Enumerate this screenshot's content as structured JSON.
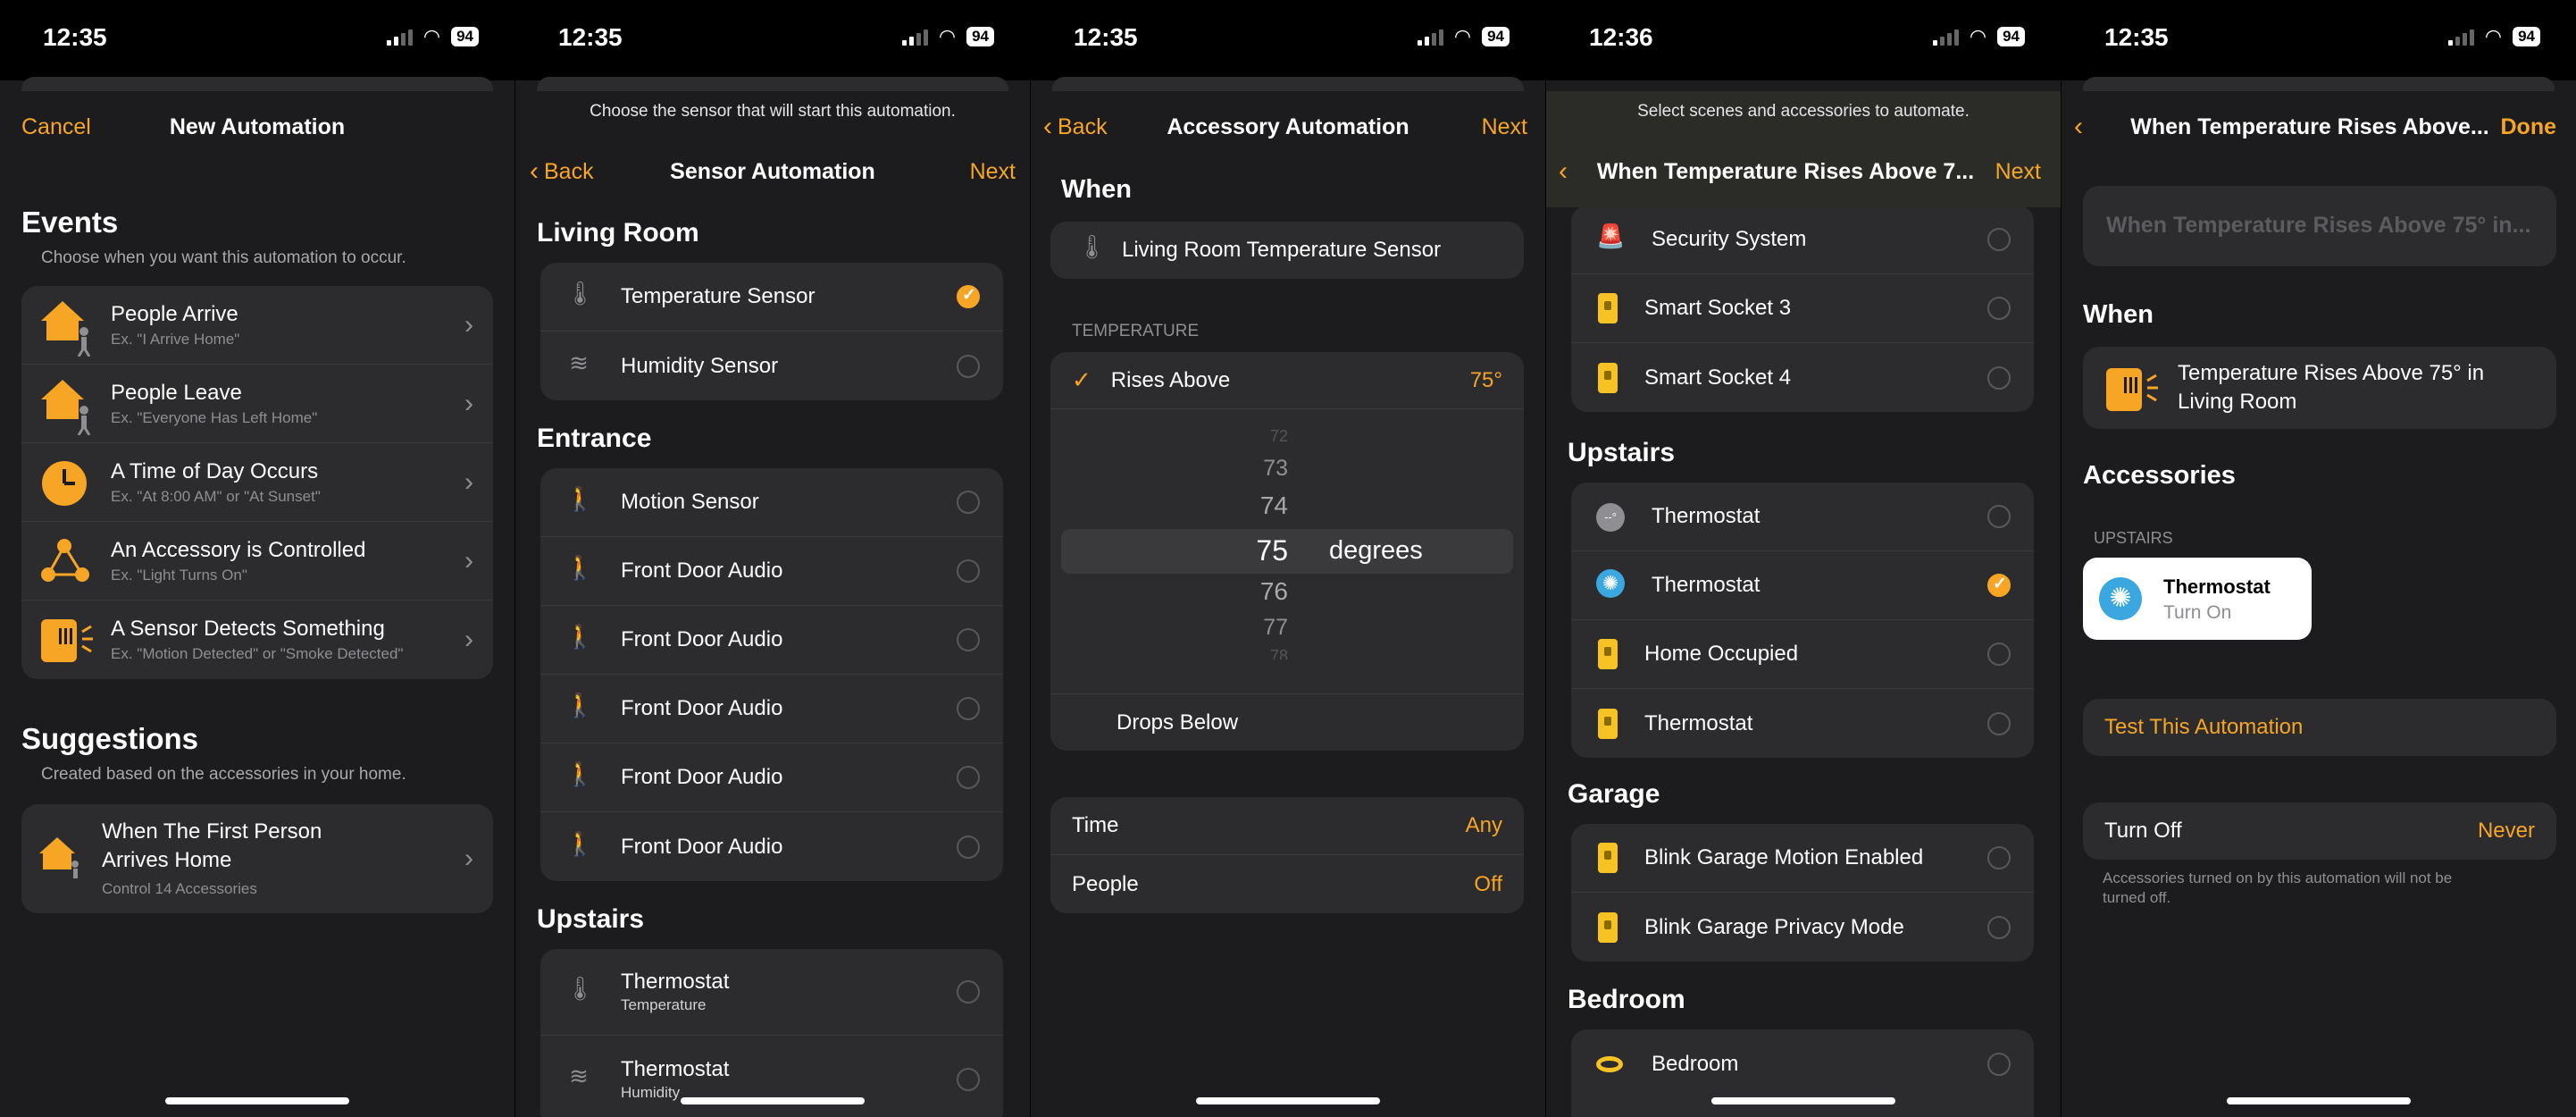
{
  "status": [
    {
      "time": "12:35",
      "battery": "94"
    },
    {
      "time": "12:35",
      "battery": "94"
    },
    {
      "time": "12:35",
      "battery": "94"
    },
    {
      "time": "12:36",
      "battery": "94"
    },
    {
      "time": "12:35",
      "battery": "94"
    }
  ],
  "s1": {
    "cancel": "Cancel",
    "title": "New Automation",
    "events_title": "Events",
    "events_sub": "Choose when you want this automation to occur.",
    "events": [
      {
        "label": "People Arrive",
        "sub": "Ex. \"I Arrive Home\"",
        "icon": "house-person-icon"
      },
      {
        "label": "People Leave",
        "sub": "Ex. \"Everyone Has Left Home\"",
        "icon": "house-person-icon"
      },
      {
        "label": "A Time of Day Occurs",
        "sub": "Ex. \"At 8:00 AM\" or \"At Sunset\"",
        "icon": "clock-icon"
      },
      {
        "label": "An Accessory is Controlled",
        "sub": "Ex. \"Light Turns On\"",
        "icon": "network-icon"
      },
      {
        "label": "A Sensor Detects Something",
        "sub": "Ex. \"Motion Detected\" or \"Smoke Detected\"",
        "icon": "sensor-icon"
      }
    ],
    "sugg_title": "Suggestions",
    "sugg_sub": "Created based on the accessories in your home.",
    "sugg": {
      "line1": "When The First Person",
      "line2": "Arrives Home",
      "sub": "Control 14 Accessories"
    }
  },
  "s2": {
    "prompt": "Choose the sensor that will start this automation.",
    "back": "Back",
    "title": "Sensor Automation",
    "next": "Next",
    "living_room": "Living Room",
    "living": [
      {
        "label": "Temperature Sensor",
        "checked": true
      },
      {
        "label": "Humidity Sensor",
        "checked": false
      }
    ],
    "entrance": "Entrance",
    "entrance_items": [
      "Motion Sensor",
      "Front Door Audio",
      "Front Door Audio",
      "Front Door Audio",
      "Front Door Audio",
      "Front Door Audio"
    ],
    "upstairs": "Upstairs",
    "upstairs_items": [
      {
        "label": "Thermostat",
        "sub": "Temperature"
      },
      {
        "label": "Thermostat",
        "sub": "Humidity"
      }
    ]
  },
  "s3": {
    "back": "Back",
    "title": "Accessory Automation",
    "next": "Next",
    "when": "When",
    "sensor": "Living Room Temperature Sensor",
    "temp_header": "TEMPERATURE",
    "rises": "Rises Above",
    "rises_val": "75°",
    "picker": [
      "72",
      "73",
      "74",
      "75",
      "76",
      "77",
      "78"
    ],
    "degrees": "degrees",
    "drops": "Drops Below",
    "time_label": "Time",
    "time_val": "Any",
    "people_label": "People",
    "people_val": "Off"
  },
  "s4": {
    "prompt": "Select scenes and accessories to automate.",
    "title": "When Temperature Rises Above 7...",
    "next": "Next",
    "top_items": [
      {
        "label": "Security System",
        "icon": "security-icon"
      },
      {
        "label": "Smart Socket 3",
        "icon": "socket-icon"
      },
      {
        "label": "Smart Socket 4",
        "icon": "socket-icon"
      }
    ],
    "upstairs": "Upstairs",
    "upstairs_items": [
      {
        "label": "Thermostat",
        "icon": "thermostat-off-icon",
        "checked": false
      },
      {
        "label": "Thermostat",
        "icon": "fan-icon",
        "checked": true
      },
      {
        "label": "Home Occupied",
        "icon": "socket-icon",
        "checked": false
      },
      {
        "label": "Thermostat",
        "icon": "socket-icon",
        "checked": false
      }
    ],
    "garage": "Garage",
    "garage_items": [
      "Blink Garage Motion Enabled",
      "Blink Garage Privacy Mode"
    ],
    "bedroom": "Bedroom",
    "bedroom_items": [
      "Bedroom"
    ]
  },
  "s5": {
    "title": "When Temperature Rises Above...",
    "done": "Done",
    "name_placeholder": "When Temperature Rises Above 75° in...",
    "when": "When",
    "when_line1": "Temperature Rises Above 75° in",
    "when_line2": "Living Room",
    "accessories": "Accessories",
    "upstairs": "UPSTAIRS",
    "tile_name": "Thermostat",
    "tile_state": "Turn On",
    "test": "Test This Automation",
    "turn_off": "Turn Off",
    "turn_off_val": "Never",
    "footnote_l1": "Accessories turned on by this automation will not be",
    "footnote_l2": "turned off."
  },
  "colors": {
    "accent": "#f7a524",
    "bg": "#1c1c1e",
    "cell": "#2c2c2e",
    "fan": "#3aa7e0"
  }
}
